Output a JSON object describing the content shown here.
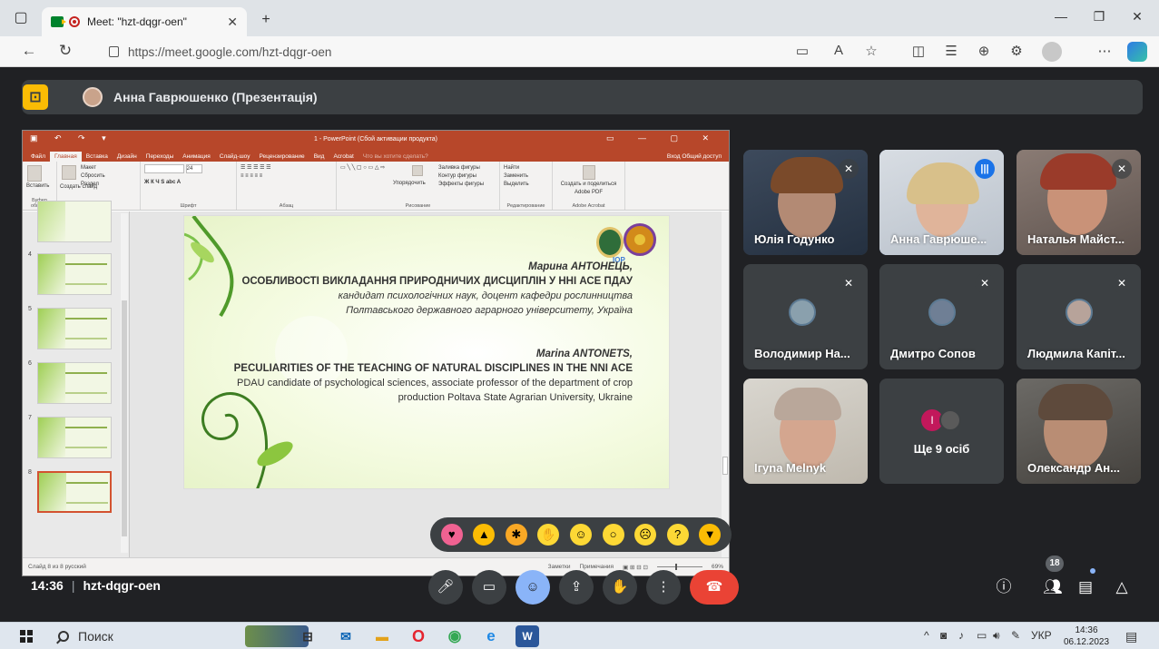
{
  "browser": {
    "tab_title": "Meet: \"hzt-dqgr-oen\"",
    "tab_close": "✕",
    "new_tab": "+",
    "url": "https://meet.google.com/hzt-dqgr-oen",
    "url_host": "https://meet.google.com",
    "url_path": "/hzt-dqgr-oen"
  },
  "meet": {
    "presenter_label": "Анна Гаврюшенко (Презентація)",
    "meeting_time": "14:36",
    "meeting_code": "hzt-dqgr-oen",
    "people_count": "18",
    "more_people_label": "Ще 9 осіб",
    "more_people_initial": "I",
    "participants": [
      {
        "name": "Юлія Годунко",
        "muted": true
      },
      {
        "name": "Анна Гаврюше...",
        "speaking": true
      },
      {
        "name": "Наталья Майст...",
        "muted": true
      },
      {
        "name": "Володимир На...",
        "muted": true
      },
      {
        "name": "Дмитро Сопов",
        "muted": true
      },
      {
        "name": "Людмила Капіт...",
        "muted": true
      },
      {
        "name": "Iгуna Melnyk"
      },
      {
        "name": "Олександр Ан..."
      }
    ],
    "accent_color": "#8ab4f8",
    "leave_color": "#ea4335"
  },
  "powerpoint": {
    "window_title": "1 - PowerPoint (Сбой активации продукта)",
    "tabs": [
      "Файл",
      "Главная",
      "Вставка",
      "Дизайн",
      "Переходы",
      "Анимация",
      "Слайд-шоу",
      "Рецензирование",
      "Вид",
      "Acrobat",
      "Что вы хотите сделать?"
    ],
    "sign_in": "Вход  Общий доступ",
    "ribbon": {
      "paste": "Вставить",
      "clipboard": "Буфер обмена",
      "new_slide": "Создать слайд",
      "layout": "Макет",
      "reset": "Сбросить",
      "section": "Раздел",
      "slides": "Слайды",
      "font_size": "24",
      "font_group": "Шрифт",
      "paragraph": "Абзац",
      "arrange": "Упорядочить",
      "express": "Экспресс-стили",
      "fill": "Заливка фигуры",
      "outline": "Контур фигуры",
      "effects": "Эффекты фигуры",
      "drawing": "Рисование",
      "find": "Найти",
      "replace": "Заменить",
      "select": "Выделить",
      "editing": "Редактирование",
      "create_pdf": "Создать и поделиться Adobe PDF",
      "acrobat": "Adobe Acrobat"
    },
    "thumb_numbers": [
      "4",
      "5",
      "6",
      "7",
      "8"
    ],
    "status_left": "Слайд 8 из 8   русский",
    "status_notes": "Заметки",
    "status_comments": "Примечания",
    "zoom": "69%",
    "slide": {
      "author_uk": "Марина АНТОНЕЦЬ,",
      "title_uk": "ОСОБЛИВОСТІ ВИКЛАДАННЯ ПРИРОДНИЧИХ ДИСЦИПЛІН У ННІ АСЕ ПДАУ",
      "sub_uk_1": "кандидат психологічних наук, доцент кафедри рослинництва",
      "sub_uk_2": "Полтавського державного аграрного університету, Україна",
      "author_en": "Marina ANTONETS,",
      "title_en": "PECULIARITIES OF THE TEACHING OF NATURAL DISCIPLINES IN THE NNI ACE",
      "sub_en_1": "PDAU candidate of psychological sciences, associate professor of the department of crop",
      "sub_en_2": "production Poltava State Agrarian University, Ukraine",
      "logo_text": "ІОР"
    }
  },
  "taskbar": {
    "search": "Поиск",
    "lang": "УКР",
    "time": "14:36",
    "date": "06.12.2023"
  }
}
